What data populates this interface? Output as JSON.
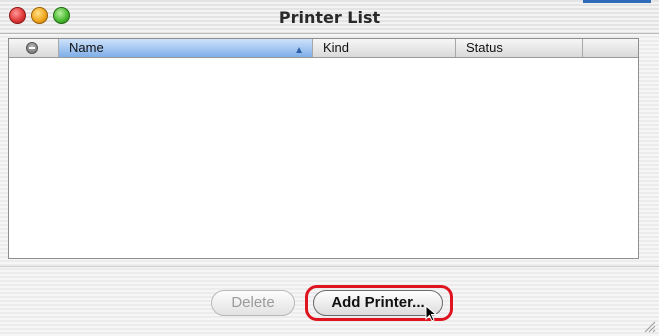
{
  "window": {
    "title": "Printer List"
  },
  "table": {
    "columns": [
      {
        "label": "Name",
        "sorted": true,
        "sort_direction": "ascending"
      },
      {
        "label": "Kind"
      },
      {
        "label": "Status"
      },
      {
        "label": ""
      }
    ],
    "rows": []
  },
  "buttons": {
    "delete_label": "Delete",
    "delete_enabled": false,
    "add_label": "Add Printer...",
    "add_default": true
  },
  "annotation": {
    "highlight_color": "#e0141e",
    "target": "add-printer-button"
  },
  "colors": {
    "selected_column": "#7eaee8",
    "close": "#e23a3a",
    "minimize": "#f0a91f",
    "zoom": "#4cbb33"
  },
  "icons": {
    "status_column": "status-dot-icon",
    "sort": "sort-ascending-icon",
    "cursor": "mouse-pointer-icon",
    "resize": "resize-grip-icon"
  }
}
